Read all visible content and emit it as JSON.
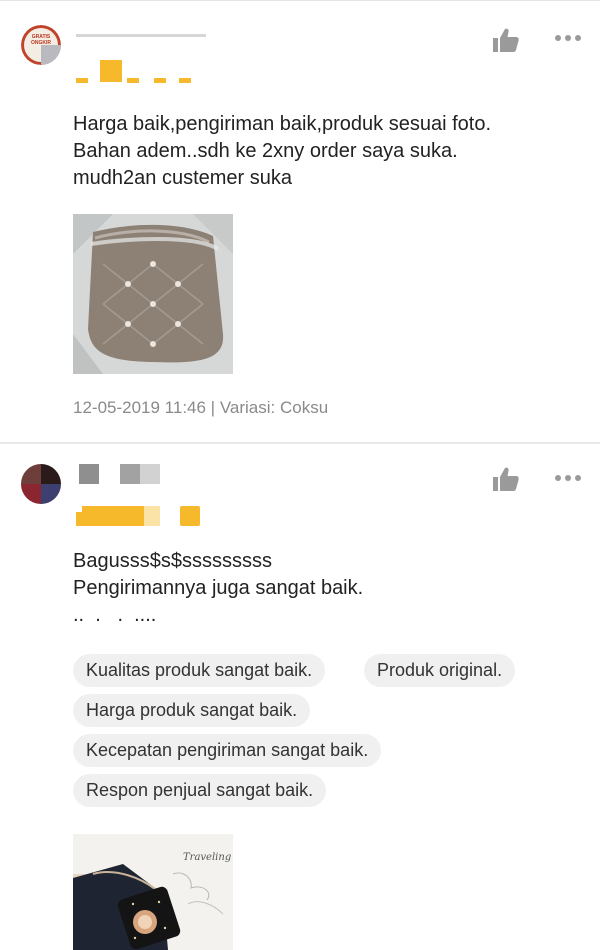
{
  "reviews": [
    {
      "avatar_text": "GRATIS ONGKIR",
      "rating": 5,
      "comment_lines": [
        "Harga baik,pengiriman baik,produk sesuai foto.",
        "Bahan adem..sdh ke 2xny order saya suka.",
        "mudh2an custemer suka"
      ],
      "meta": "12-05-2019 11:46 | Variasi: Coksu",
      "icons": {
        "like": "thumbs-up-icon",
        "more": "more-horizontal-icon"
      }
    },
    {
      "rating": 5,
      "comment_lines": [
        "Bagusss$s$sssssssss",
        "Pengirimannya juga sangat baik.",
        "..  .   .  ...."
      ],
      "tags": [
        "Kualitas produk sangat baik.",
        "Produk original.",
        "Harga produk sangat baik.",
        "Kecepatan pengiriman sangat baik.",
        "Respon penjual sangat baik."
      ],
      "image_caption": "Traveling",
      "icons": {
        "like": "thumbs-up-icon",
        "more": "more-horizontal-icon"
      }
    }
  ],
  "colors": {
    "star": "#f6b92b",
    "meta_text": "#8a8a8a",
    "chip_bg": "#f0f0f0"
  }
}
